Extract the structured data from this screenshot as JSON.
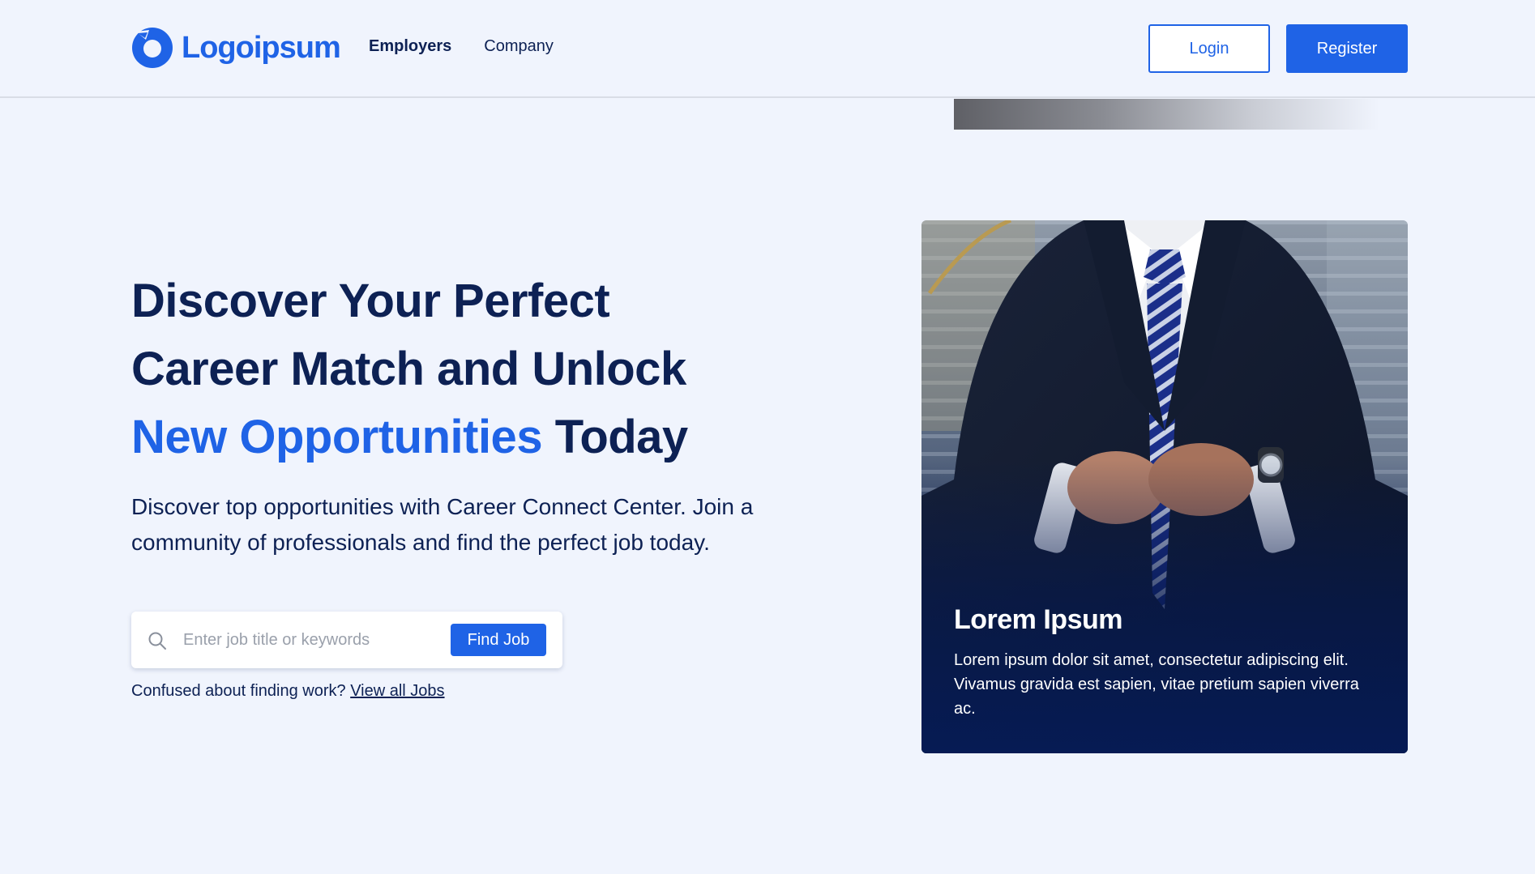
{
  "brand": {
    "name": "Logoipsum",
    "accent": "#1f63e6",
    "navy": "#0d2154"
  },
  "nav": {
    "items": [
      {
        "label": "Employers",
        "active": true
      },
      {
        "label": "Company",
        "active": false
      }
    ]
  },
  "auth": {
    "login_label": "Login",
    "register_label": "Register"
  },
  "hero": {
    "title_line1": "Discover Your Perfect",
    "title_line2": "Career Match and Unlock",
    "title_accent": "New Opportunities",
    "title_tail": " Today",
    "subtitle": "Discover top opportunities with Career Connect Center. Join a community of professionals and find the perfect job today."
  },
  "search": {
    "icon": "search-icon",
    "placeholder": "Enter job title or keywords",
    "value": "",
    "button_label": "Find Job"
  },
  "help": {
    "text": "Confused about finding work? ",
    "link_label": "View all Jobs"
  },
  "card": {
    "title": "Lorem Ipsum",
    "text": "Lorem ipsum dolor sit amet, consectetur adipiscing elit. Vivamus gravida est sapien, vitae pretium sapien viverra ac."
  }
}
